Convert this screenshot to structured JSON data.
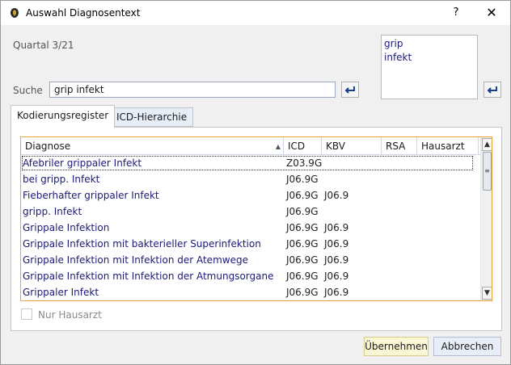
{
  "window": {
    "title": "Auswahl Diagnosentext",
    "help_label": "?",
    "close_label": "✕"
  },
  "quartal": "Quartal 3/21",
  "search_terms": [
    "grip",
    "infekt"
  ],
  "search": {
    "label": "Suche",
    "value": "grip infekt"
  },
  "tabs": [
    {
      "label": "Kodierungsregister",
      "active": true
    },
    {
      "label": "ICD-Hierarchie",
      "active": false
    }
  ],
  "grid": {
    "columns": [
      "Diagnose",
      "ICD",
      "KBV",
      "RSA",
      "Hausarzt"
    ],
    "rows": [
      {
        "diagnose": "Afebriler grippaler Infekt",
        "icd": "Z03.9G",
        "kbv": "",
        "selected": true
      },
      {
        "diagnose": "bei gripp. Infekt",
        "icd": "J06.9G",
        "kbv": ""
      },
      {
        "diagnose": "Fieberhafter grippaler Infekt",
        "icd": "J06.9G",
        "kbv": "J06.9"
      },
      {
        "diagnose": "gripp. Infekt",
        "icd": "J06.9G",
        "kbv": ""
      },
      {
        "diagnose": "Grippale Infektion",
        "icd": "J06.9G",
        "kbv": "J06.9"
      },
      {
        "diagnose": "Grippale Infektion mit bakterieller Superinfektion",
        "icd": "J06.9G",
        "kbv": "J06.9"
      },
      {
        "diagnose": "Grippale Infektion mit Infektion der Atemwege",
        "icd": "J06.9G",
        "kbv": "J06.9"
      },
      {
        "diagnose": "Grippale Infektion mit Infektion der Atmungsorgane",
        "icd": "J06.9G",
        "kbv": "J06.9"
      },
      {
        "diagnose": "Grippaler Infekt",
        "icd": "J06.9G",
        "kbv": "J06.9"
      }
    ]
  },
  "nur_hausarzt": {
    "label": "Nur Hausarzt",
    "checked": false
  },
  "buttons": {
    "ok": "Übernehmen",
    "cancel": "Abbrechen"
  },
  "colors": {
    "grid_focus_border": "#e8a33c",
    "row_text": "#1a1a7a",
    "ok_button_bg": "#fbf6d3",
    "cancel_button_bg": "#e8eef8"
  }
}
